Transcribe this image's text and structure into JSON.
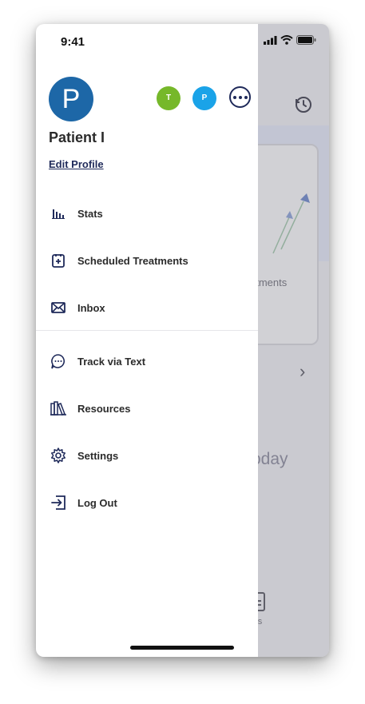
{
  "status_bar": {
    "time": "9:41"
  },
  "profile": {
    "avatar_initial": "P",
    "name": "Patient I",
    "edit_label": "Edit Profile",
    "switchers": [
      "T",
      "P"
    ]
  },
  "menu": {
    "primary": [
      {
        "label": "Stats",
        "icon": "stats-bar-chart-icon"
      },
      {
        "label": "Scheduled Treatments",
        "icon": "scheduled-treatments-icon"
      },
      {
        "label": "Inbox",
        "icon": "envelope-icon"
      }
    ],
    "secondary": [
      {
        "label": "Track via Text",
        "icon": "chat-bubble-icon"
      },
      {
        "label": "Resources",
        "icon": "books-icon"
      },
      {
        "label": "Settings",
        "icon": "gear-icon"
      },
      {
        "label": "Log Out",
        "icon": "logout-icon"
      }
    ]
  },
  "background_screen": {
    "card_text": "atments",
    "section_text": "oday",
    "tab_label": "rds"
  },
  "colors": {
    "avatar_main": "#1d67a7",
    "avatar_t": "#76b82a",
    "avatar_p": "#1aa3e8",
    "navy": "#1f2a5a"
  }
}
